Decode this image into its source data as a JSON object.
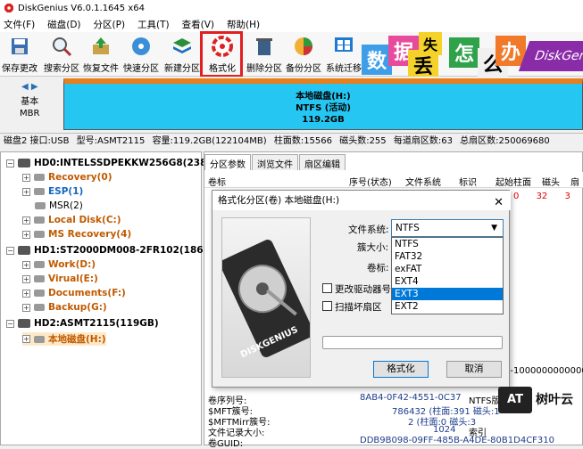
{
  "app": {
    "title": "DiskGenius V6.0.1.1645 x64"
  },
  "menu": [
    "文件(F)",
    "磁盘(D)",
    "分区(P)",
    "工具(T)",
    "查看(V)",
    "帮助(H)"
  ],
  "toolbar": [
    "保存更改",
    "搜索分区",
    "恢复文件",
    "快速分区",
    "新建分区",
    "格式化",
    "删除分区",
    "备份分区",
    "系统迁移"
  ],
  "banner": {
    "chars": [
      "数",
      "据",
      "丢",
      "失",
      "怎",
      "么",
      "办"
    ],
    "brand": "DiskGen"
  },
  "diskmap": {
    "basic": "基本",
    "mbr": "MBR",
    "partition_name": "本地磁盘(H:)",
    "partition_fs": "NTFS (活动)",
    "partition_size": "119.2GB"
  },
  "diskinfo": [
    "磁盘2 接口:USB",
    "型号:ASMT2115",
    "容量:119.2GB(122104MB)",
    "柱面数:15566",
    "磁头数:255",
    "每道扇区数:63",
    "总扇区数:250069680"
  ],
  "tree": {
    "hd0": "HD0:INTELSSDPEKKW256G8(238GB)",
    "hd0_parts": [
      "Recovery(0)",
      "ESP(1)",
      "MSR(2)",
      "Local Disk(C:)",
      "MS Recovery(4)"
    ],
    "hd1": "HD1:ST2000DM008-2FR102(1863GB)",
    "hd1_parts": [
      "Work(D:)",
      "Virual(E:)",
      "Documents(F:)",
      "Backup(G:)"
    ],
    "hd2": "HD2:ASMT2115(119GB)",
    "hd2_parts": [
      "本地磁盘(H:)"
    ]
  },
  "tabs": [
    "分区参数",
    "浏览文件",
    "扇区编辑"
  ],
  "columns": [
    "卷标",
    "序号(状态)",
    "文件系统",
    "标识",
    "起始柱面",
    "磁头",
    "扇"
  ],
  "row1": [
    "0",
    "32",
    "3"
  ],
  "details": {
    "right_value": "0-1000000000000",
    "serial_label": "卷序列号:",
    "serial_value": "8AB4-0F42-4551-0C37",
    "ntfs_version_label": "NTFS版本号:",
    "mft_label": "$MFT簇号:",
    "mft_value": "786432 (柱面:391 磁头:1",
    "mftmirr_label": "$MFTMirr簇号:",
    "mftmirr_value": "2 (柱面:0 磁头:3",
    "filerec_label": "文件记录大小:",
    "filerec_value": "1024",
    "index_label": "索引",
    "guid_label": "卷GUID:",
    "guid_value": "DDB9B098-09FF-485B-A4DE-80B1D4CF310"
  },
  "dialog": {
    "title": "格式化分区(卷) 本地磁盘(H:)",
    "fs_label": "文件系统:",
    "fs_value": "NTFS",
    "cluster_label": "簇大小:",
    "volume_label": "卷标:",
    "fs_options": [
      "NTFS",
      "FAT32",
      "exFAT",
      "EXT4",
      "EXT3",
      "EXT2"
    ],
    "selected_option": "EXT3",
    "change_drive_letter": "更改驱动器号",
    "scan_bad": "扫描坏扇区",
    "format_button": "格式化",
    "cancel_button": "取消",
    "brand_text": "DISKGENIUS"
  },
  "watermark": {
    "badge": "AT",
    "text": "树叶云"
  },
  "colors": {
    "accent_red": "#e02020",
    "partition_blue": "#26c6f2",
    "partition_top": "#e87e1c",
    "tree_orange": "#c05a00",
    "selection": "#0078d7"
  }
}
